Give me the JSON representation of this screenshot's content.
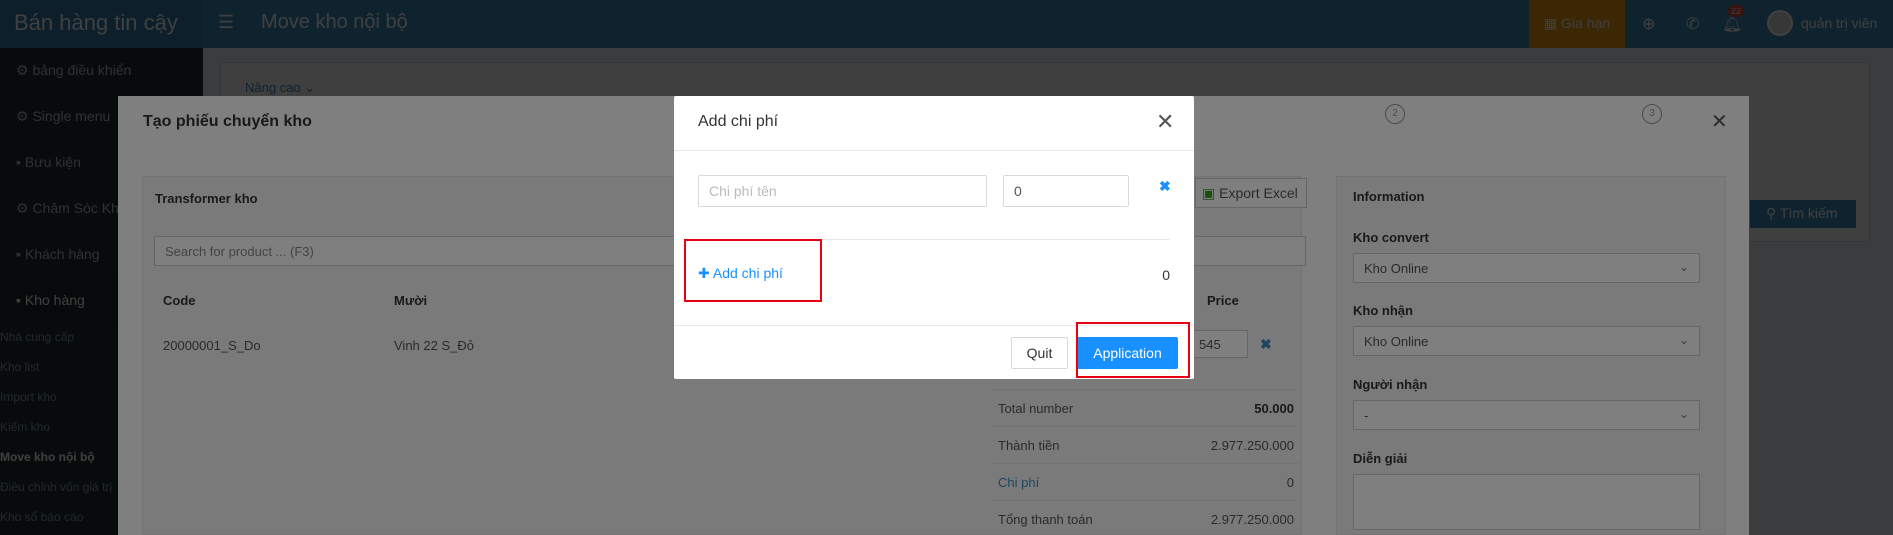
{
  "topbar": {
    "brand": "Bán hàng tin cậy",
    "title": "Move kho nội bộ",
    "renew_label": "Gia hạn",
    "notification_count": "22",
    "user_name": "quản trị viên"
  },
  "sidebar": {
    "items": [
      {
        "label": "bảng điều khiển"
      },
      {
        "label": "Single menu"
      },
      {
        "label": "Bưu kiện"
      },
      {
        "label": "Chăm Sóc Khách"
      },
      {
        "label": "Khách hàng"
      },
      {
        "label": "Kho hàng"
      }
    ],
    "subitems": [
      {
        "label": "Nhà cung cấp"
      },
      {
        "label": "Kho list"
      },
      {
        "label": "Import kho"
      },
      {
        "label": "Kiểm kho"
      },
      {
        "label": "Move kho nội bộ"
      },
      {
        "label": "Điều chỉnh vốn giá trị"
      },
      {
        "label": "Kho sổ báo cáo"
      }
    ]
  },
  "background": {
    "advanced_tab": "Nâng cao ⌄",
    "search_button": "Tìm kiếm"
  },
  "transfer_modal": {
    "title": "Tạo phiếu chuyển kho",
    "steps": [
      "2",
      "3"
    ],
    "left_panel_title": "Transformer kho",
    "export_label": "Export Excel",
    "product_search_placeholder": "Search for product ... (F3)",
    "columns": {
      "code": "Code",
      "name": "Mười",
      "price": "Price"
    },
    "row": {
      "code": "20000001_S_Do",
      "name": "Vinh 22 S_Đỏ",
      "price": "545"
    },
    "summary": {
      "total_number_label": "Total number",
      "total_number": "50.000",
      "subtotal_label": "Thành tiền",
      "subtotal": "2.977.250.000",
      "cost_label": "Chi phí",
      "cost": "0",
      "grand_total_label": "Tổng thanh toán",
      "grand_total": "2.977.250.000"
    },
    "info": {
      "title": "Information",
      "source_label": "Kho convert",
      "source_value": "Kho Online",
      "dest_label": "Kho nhận",
      "dest_value": "Kho Online",
      "receiver_label": "Người nhận",
      "receiver_value": "-",
      "note_label": "Diễn giải"
    }
  },
  "cost_modal": {
    "title": "Add chi phí",
    "name_placeholder": "Chi phí tên",
    "value": "0",
    "add_link": "Add chi phí",
    "total": "0",
    "quit_label": "Quit",
    "apply_label": "Application"
  }
}
